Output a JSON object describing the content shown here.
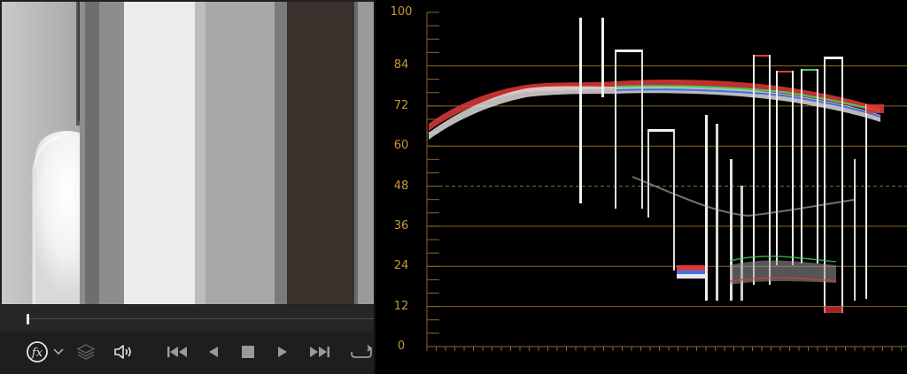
{
  "viewer": {
    "controls": {
      "fx_label": "fx",
      "fx_dropdown_icon": "chevron-down-icon",
      "layers_icon": "layers-icon",
      "volume_icon": "speaker-icon",
      "skip_back_icon": "skip-to-start-icon",
      "play_reverse_icon": "play-reverse-icon",
      "stop_icon": "stop-icon",
      "play_icon": "play-icon",
      "skip_forward_icon": "skip-to-end-icon",
      "loop_icon": "loop-icon"
    },
    "playhead_position": 0.0
  },
  "scope": {
    "type": "waveform",
    "y_axis_labels": [
      "100",
      "84",
      "72",
      "60",
      "48",
      "36",
      "24",
      "12",
      "0"
    ],
    "y_axis_values": [
      100,
      84,
      72,
      60,
      48,
      36,
      24,
      12,
      0
    ],
    "y_range": [
      0,
      100
    ],
    "reference_dashed_line": 48,
    "gridline_color": "#8a6a20",
    "label_color": "#c59a3a",
    "trace_colors": {
      "red": "#e0393a",
      "green": "#3fcf5a",
      "blue": "#3f6fe8",
      "white": "#f0f0f0"
    }
  }
}
